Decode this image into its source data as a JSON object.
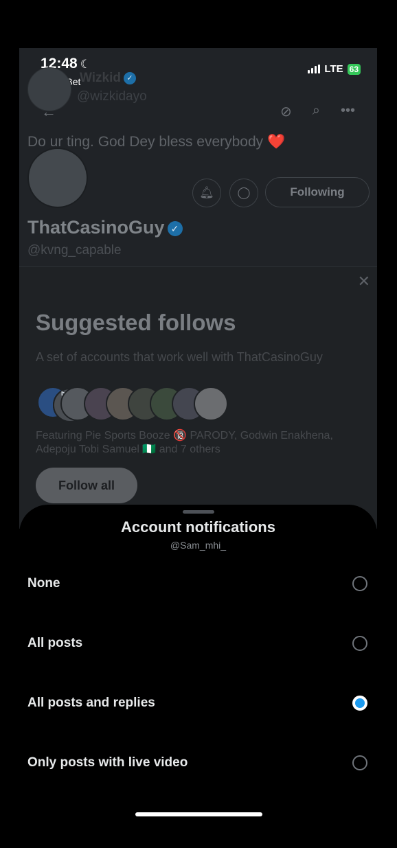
{
  "status_bar": {
    "time": "12:48",
    "back_app": "◂ SportyBet",
    "network": "LTE",
    "battery": "63"
  },
  "profile_header": {
    "name": "Wizkid",
    "handle": "@wizkidayo",
    "bio": "Do ur ting. God Dey bless everybody ❤️"
  },
  "profile": {
    "name": "ThatCasinoGuy",
    "handle": "@kvng_capable",
    "following_label": "Following"
  },
  "suggested": {
    "title": "Suggested follows",
    "description": "A set of accounts that work well with ThatCasinoGuy",
    "featuring": "Featuring Pie Sports Booze 🔞 PARODY, Godwin Enakhena, Adepoju Tobi Samuel 🇳🇬 and 7 others",
    "follow_all_label": "Follow all",
    "pie_logo": {
      "line1": "pie",
      "line2": "sports",
      "line3": "booze"
    }
  },
  "sheet": {
    "title": "Account notifications",
    "subtitle": "@Sam_mhi_",
    "options": [
      {
        "label": "None",
        "selected": false
      },
      {
        "label": "All posts",
        "selected": false
      },
      {
        "label": "All posts and replies",
        "selected": true
      },
      {
        "label": "Only posts with live video",
        "selected": false
      }
    ]
  },
  "colors": {
    "accent": "#1d9bf0",
    "sheet_bg": "#000000"
  }
}
